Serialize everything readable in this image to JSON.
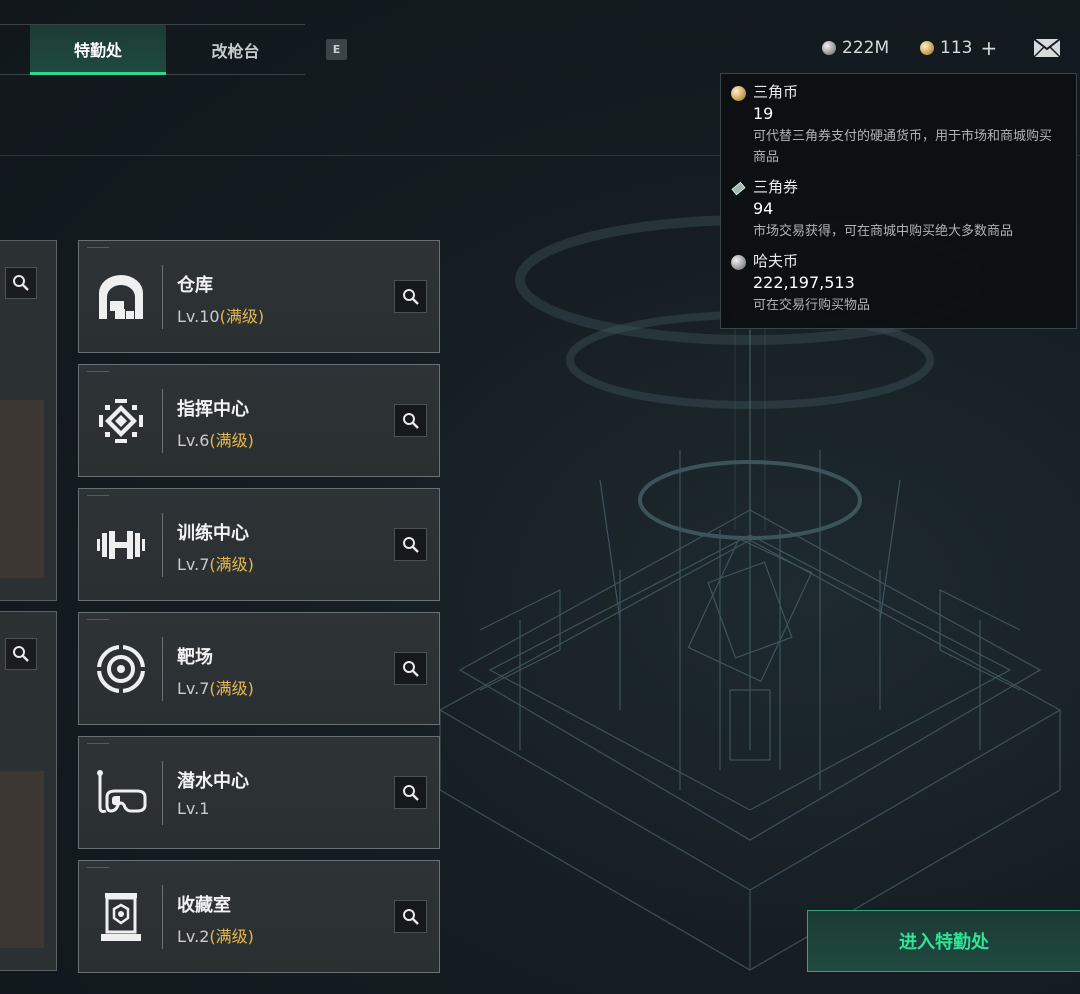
{
  "tabs": {
    "active_label": "特勤处",
    "gun_label": "改枪台",
    "key_hint": "E"
  },
  "currency": {
    "haf_amount": "222M",
    "tri_amount": "113",
    "plus": "+"
  },
  "tooltip": {
    "items": [
      {
        "name": "三角币",
        "value": "19",
        "desc": "可代替三角券支付的硬通货币，用于市场和商城购买商品"
      },
      {
        "name": "三角券",
        "value": "94",
        "desc": "市场交易获得，可在商城中购买绝大多数商品"
      },
      {
        "name": "哈夫币",
        "value": "222,197,513",
        "desc": "可在交易行购买物品"
      }
    ]
  },
  "facilities": [
    {
      "name": "仓库",
      "level": "Lv.10",
      "max": "(满级)",
      "icon": "warehouse-icon"
    },
    {
      "name": "指挥中心",
      "level": "Lv.6",
      "max": "(满级)",
      "icon": "command-center-icon"
    },
    {
      "name": "训练中心",
      "level": "Lv.7",
      "max": "(满级)",
      "icon": "dumbbell-icon"
    },
    {
      "name": "靶场",
      "level": "Lv.7",
      "max": "(满级)",
      "icon": "target-icon"
    },
    {
      "name": "潜水中心",
      "level": "Lv.1",
      "max": "",
      "icon": "diving-mask-icon"
    },
    {
      "name": "收藏室",
      "level": "Lv.2",
      "max": "(满级)",
      "icon": "display-case-icon"
    }
  ],
  "enter_button": "进入特勤处",
  "colors": {
    "accent_green": "#2fd48e",
    "max_level_gold": "#e6b84e"
  }
}
